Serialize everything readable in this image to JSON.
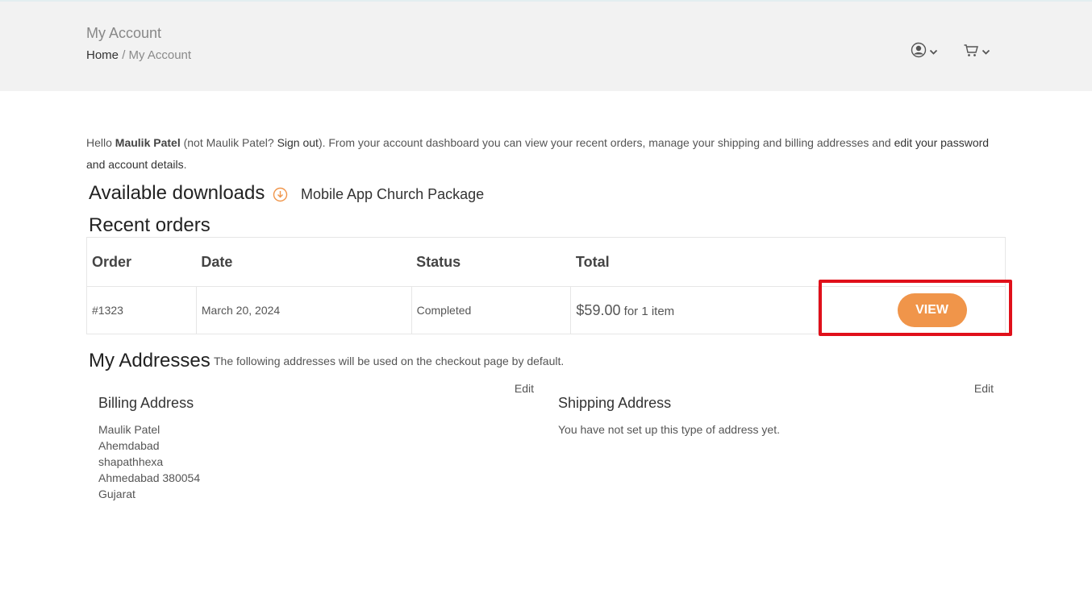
{
  "header": {
    "title": "My Account",
    "breadcrumb": {
      "home": "Home",
      "separator": "/",
      "current": "My Account"
    },
    "icons": [
      "user-icon",
      "cart-icon"
    ]
  },
  "intro": {
    "hello": "Hello ",
    "user_name": "Maulik Patel",
    "not_prefix": " (not Maulik Patel? ",
    "sign_out": "Sign out",
    "middle": "). From your account dashboard you can view your recent orders, manage your shipping and billing addresses and ",
    "edit_link": "edit your password and account details",
    "end": "."
  },
  "downloads": {
    "heading": "Available downloads",
    "item": "Mobile App Church Package"
  },
  "orders": {
    "heading": "Recent orders",
    "columns": [
      "Order",
      "Date",
      "Status",
      "Total"
    ],
    "rows": [
      {
        "order": "#1323",
        "date": "March 20, 2024",
        "status": "Completed",
        "amount": "$59.00",
        "items": " for 1 item",
        "action": "VIEW"
      }
    ]
  },
  "addresses": {
    "heading": "My Addresses",
    "note": "The following addresses will be used on the checkout page by default.",
    "billing": {
      "title": "Billing Address",
      "edit": "Edit",
      "lines": [
        "Maulik Patel",
        "Ahemdabad",
        "shapathhexa",
        "Ahmedabad 380054",
        "Gujarat"
      ]
    },
    "shipping": {
      "title": "Shipping Address",
      "edit": "Edit",
      "empty": "You have not set up this type of address yet."
    }
  },
  "colors": {
    "accent": "#f0954a",
    "highlight": "#e0101a",
    "header_bg": "#f2f2f2"
  }
}
